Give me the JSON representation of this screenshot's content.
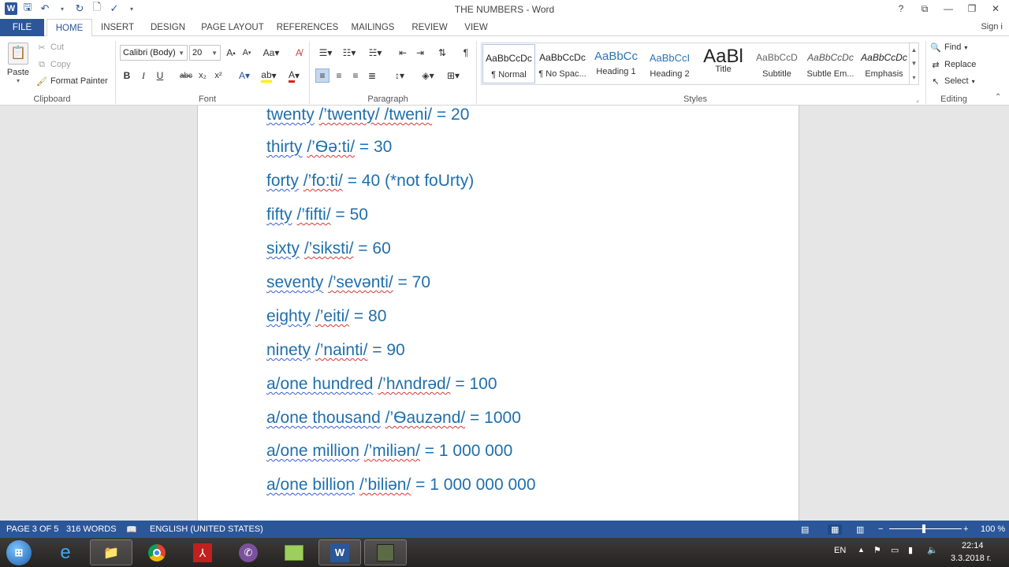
{
  "window": {
    "title": "THE NUMBERS - Word",
    "controls": [
      "?",
      "⧉",
      "—",
      "❐",
      "✕"
    ]
  },
  "qat": {
    "icons": [
      "word-logo-icon",
      "save-icon",
      "undo-icon",
      "redo-icon",
      "new-doc-icon",
      "spelling-icon",
      "customize-icon"
    ]
  },
  "tabs": {
    "file": "FILE",
    "items": [
      "HOME",
      "INSERT",
      "DESIGN",
      "PAGE LAYOUT",
      "REFERENCES",
      "MAILINGS",
      "REVIEW",
      "VIEW"
    ],
    "signin": "Sign i"
  },
  "ribbon": {
    "clipboard": {
      "paste": "Paste",
      "cut": "Cut",
      "copy": "Copy",
      "format_painter": "Format Painter",
      "label": "Clipboard"
    },
    "font": {
      "font_name": "Calibri (Body)",
      "font_size": "20",
      "bold": "B",
      "italic": "I",
      "underline": "U",
      "strike": "abc",
      "subscript": "x₂",
      "superscript": "x²",
      "label": "Font"
    },
    "paragraph": {
      "label": "Paragraph"
    },
    "styles": {
      "label": "Styles",
      "items": [
        {
          "preview": "AaBbCcDc",
          "name": "¶ Normal"
        },
        {
          "preview": "AaBbCcDc",
          "name": "¶ No Spac..."
        },
        {
          "preview": "AaBbCc",
          "name": "Heading 1"
        },
        {
          "preview": "AaBbCcI",
          "name": "Heading 2"
        },
        {
          "preview": "AaBl",
          "name": "Title"
        },
        {
          "preview": "AaBbCcD",
          "name": "Subtitle"
        },
        {
          "preview": "AaBbCcDc",
          "name": "Subtle Em..."
        },
        {
          "preview": "AaBbCcDc",
          "name": "Emphasis"
        }
      ]
    },
    "editing": {
      "find": "Find",
      "replace": "Replace",
      "select": "Select",
      "label": "Editing"
    }
  },
  "document": {
    "lines": [
      {
        "w": "twenty",
        "p": "/’twenty/ /tweni/",
        "r": " = 20"
      },
      {
        "w": "thirty",
        "p": "/’Ѳə:ti/",
        "r": " = 30"
      },
      {
        "w": "forty",
        "p": "/’fo:ti/",
        "r": " = 40 (*not foUrty)"
      },
      {
        "w": "fifty",
        "p": "/’fifti/",
        "r": " = 50"
      },
      {
        "w": "sixty",
        "p": "/’siksti/",
        "r": " = 60"
      },
      {
        "w": "seventy",
        "p": "/’sevənti/",
        "r": " = 70"
      },
      {
        "w": "eighty",
        "p": "/’eiti/",
        "r": " = 80"
      },
      {
        "w": "ninety",
        "p": "/’nainti/",
        "r": " = 90"
      },
      {
        "w": "a/one hundred",
        "p": "/’hʌndrəd/",
        "r": " = 100"
      },
      {
        "w": "a/one thousand",
        "p": "/’Ѳauzənd/",
        "r": " = 1000"
      },
      {
        "w": "a/one million",
        "p": "/’miliən/",
        "r": " = 1 000 000"
      },
      {
        "w": "a/one billion",
        "p": "/’biliən/",
        "r": " = 1 000 000 000"
      }
    ]
  },
  "status": {
    "page": "PAGE 3 OF 5",
    "words": "316 WORDS",
    "language": "ENGLISH (UNITED STATES)",
    "zoom": "100 %"
  },
  "taskbar": {
    "apps": [
      "explorer-icon",
      "chrome-icon",
      "acrobat-icon",
      "viber-icon",
      "notepad-icon",
      "word-icon",
      "app-icon"
    ],
    "lang": "EN",
    "time": "22:14",
    "date": "3.3.2018 г."
  }
}
